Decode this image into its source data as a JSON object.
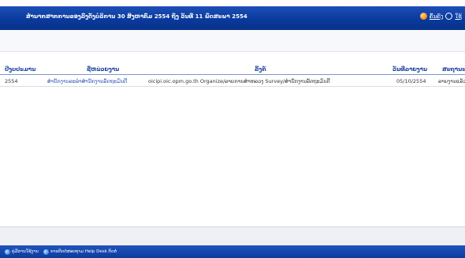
{
  "header": {
    "title": "ສຳນາກສາກການຂອງລົງດັ່ງບໍລິການ 30 ສິງຫາຄົມ 2554 ຖຶງ ວັນທີ່ 11 ພຶດສະພາ 2554",
    "actions": [
      {
        "label": "ຄົ້ນຄົງ",
        "icon": "orange-circle-icon"
      },
      {
        "label": "ໃຊ້",
        "icon": "clock-icon"
      }
    ]
  },
  "table": {
    "columns": [
      "ປີງບປະມານ",
      "ຊື່ຫນ່ວຍງານ",
      "ລິ້ງຄ໌",
      "ວັນທີ່ລາຍງານ",
      "ສະຖານະ"
    ],
    "rows": [
      {
        "year": "2554",
        "agency": "ສຳນັກງານລະລຳສຳນັກງານລັດຖະມົນຕີ",
        "link": "oicipi.oic.opm.go.th Organize/ລາຍການສຳຫລວງ Survey/ສຳນັກງານລັດຖະມົນຕີ",
        "date": "05/10/2554",
        "status": "ລາຍງານແລ້ວ"
      }
    ]
  },
  "footer": {
    "items": [
      {
        "label": "ຄູ່ມືການໃຊ້ງານ",
        "icon": "help-icon"
      },
      {
        "label": "ການຕິດຕໍ່ສອບຖາມ Help Desk ຕິດຕໍ່",
        "icon": "info-icon"
      }
    ]
  },
  "colors": {
    "title_bar": "#0a3a9c",
    "header_text": "#1a3f9a",
    "link_text": "#2a53b3",
    "status_bar": "#0c3c9e"
  }
}
